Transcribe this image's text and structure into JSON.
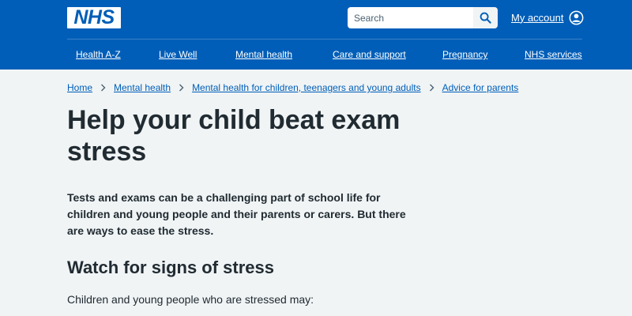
{
  "header": {
    "logo_text": "NHS",
    "search": {
      "placeholder": "Search"
    },
    "account_label": "My account",
    "nav": [
      {
        "label": "Health A-Z"
      },
      {
        "label": "Live Well"
      },
      {
        "label": "Mental health"
      },
      {
        "label": "Care and support"
      },
      {
        "label": "Pregnancy"
      },
      {
        "label": "NHS services"
      }
    ]
  },
  "breadcrumb": [
    {
      "label": "Home"
    },
    {
      "label": "Mental health"
    },
    {
      "label": "Mental health for children, teenagers and young adults"
    },
    {
      "label": "Advice for parents"
    }
  ],
  "main": {
    "title": "Help your child beat exam stress",
    "lede": "Tests and exams can be a challenging part of school life for children and young people and their parents or carers. But there are ways to ease the stress.",
    "section_heading": "Watch for signs of stress",
    "section_text": "Children and young people who are stressed may:"
  },
  "colors": {
    "header_blue": "#005eb8",
    "page_background": "#f0f4f5",
    "text": "#212b32",
    "link": "#005eb8"
  },
  "icons": {
    "search": "search-icon",
    "account": "user-circle-icon",
    "breadcrumb_separator": "chevron-right-icon"
  }
}
